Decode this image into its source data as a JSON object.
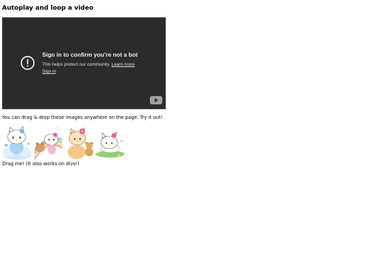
{
  "page": {
    "heading": "Autoplay and loop a video"
  },
  "video": {
    "title": "Sign in to confirm you’re not a bot",
    "subtitle": "This helps protect our community.",
    "learn_more": "Learn more",
    "sign_in": "Sign in",
    "warning_icon": "warning-circle-icon",
    "logo_icon": "youtube-logo-icon",
    "background": "#2b2b2b"
  },
  "content": {
    "hint": "You can drag & drop these images anywhere on the page. Try it out!",
    "images": [
      {
        "icon": "hello-kitty-clouds-image"
      },
      {
        "icon": "hello-kitty-rainbow-image"
      },
      {
        "icon": "hello-kitty-bear-image"
      },
      {
        "icon": "hello-kitty-grass-image"
      }
    ],
    "drag_div": "Drag me! (It also works on divs!)"
  }
}
